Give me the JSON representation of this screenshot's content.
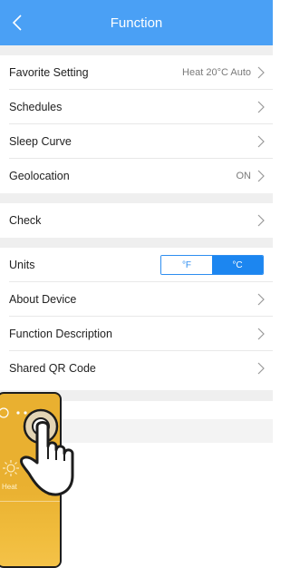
{
  "header": {
    "title": "Function",
    "back_icon": "chevron-left-icon"
  },
  "groups": [
    {
      "rows": [
        {
          "id": "favorite-setting",
          "label": "Favorite Setting",
          "value": "Heat 20°C Auto"
        },
        {
          "id": "schedules",
          "label": "Schedules",
          "value": ""
        },
        {
          "id": "sleep-curve",
          "label": "Sleep Curve",
          "value": ""
        },
        {
          "id": "geolocation",
          "label": "Geolocation",
          "value": "ON"
        }
      ]
    },
    {
      "rows": [
        {
          "id": "check",
          "label": "Check",
          "value": ""
        }
      ]
    },
    {
      "rows": [
        {
          "id": "units",
          "label": "Units",
          "toggle": [
            "°F",
            "°C"
          ],
          "selected": "°C"
        },
        {
          "id": "about-device",
          "label": "About Device",
          "value": ""
        },
        {
          "id": "function-description",
          "label": "Function Description",
          "value": ""
        },
        {
          "id": "shared-qr-code",
          "label": "Shared QR Code",
          "value": ""
        }
      ]
    }
  ],
  "phone": {
    "mode_label": "Heat",
    "mode_icon": "sun-icon",
    "more_icon": "more-dots-icon"
  },
  "colors": {
    "header": "#4aa0f5",
    "accent": "#1c86f0",
    "phone": "#e9b030"
  }
}
